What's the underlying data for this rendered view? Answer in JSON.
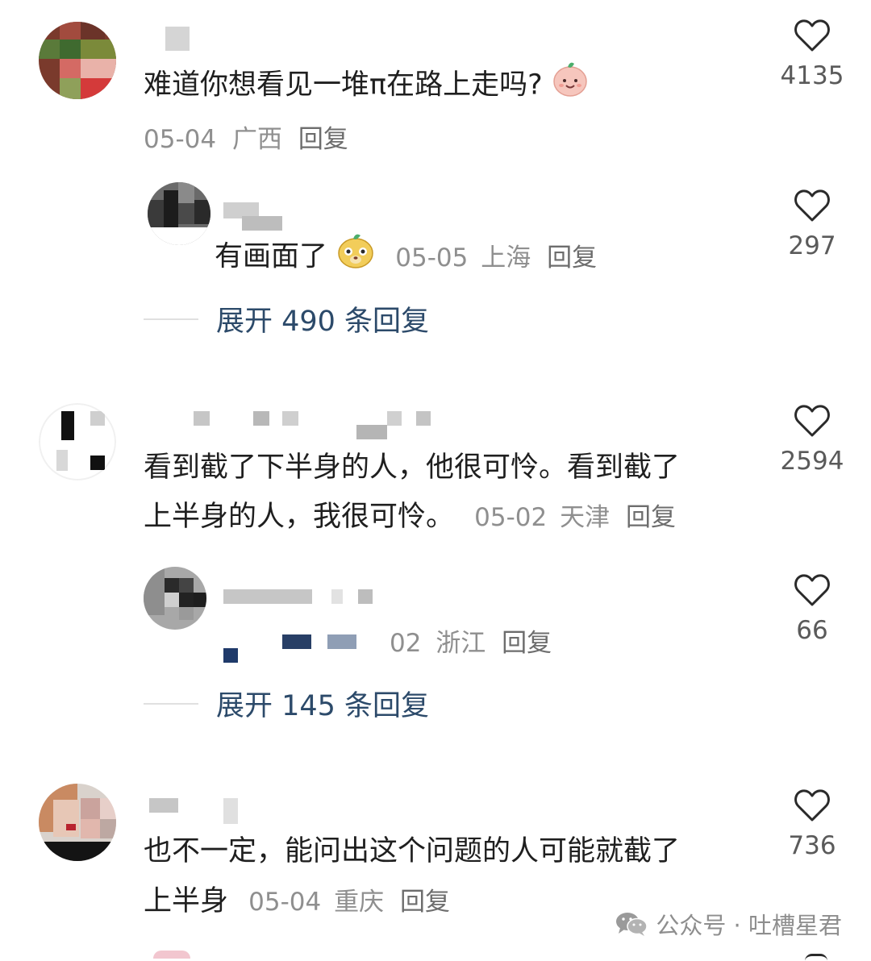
{
  "comments": [
    {
      "text": "难道你想看见一堆π在路上走吗?",
      "emoji": "smiling-peach-emoji",
      "date": "05-04",
      "location": "广西",
      "reply_label": "回复",
      "likes": "4135"
    },
    {
      "text": "有画面了",
      "emoji": "yellow-mascot-emoji",
      "date": "05-05",
      "location": "上海",
      "reply_label": "回复",
      "likes": "297",
      "expand_label": "展开 490 条回复"
    },
    {
      "text_line1": "看到截了下半身的人，他很可怜。看到截了",
      "text_line2": "上半身的人，我很可怜。",
      "date": "05-02",
      "location": "天津",
      "reply_label": "回复",
      "likes": "2594"
    },
    {
      "date_partial": "02",
      "location": "浙江",
      "reply_label": "回复",
      "likes": "66",
      "expand_label": "展开 145 条回复"
    },
    {
      "text_line1": "也不一定，能问出这个问题的人可能就截了",
      "text_line2": "上半身",
      "date": "05-04",
      "location": "重庆",
      "reply_label": "回复",
      "likes": "736"
    }
  ],
  "watermark": {
    "icon": "wechat-icon",
    "text": "公众号 · 吐槽星君"
  },
  "colors": {
    "expand_link": "#2c4a6a",
    "meta_gray": "#8f8f8f",
    "heart_stroke": "#2a2a2a"
  }
}
